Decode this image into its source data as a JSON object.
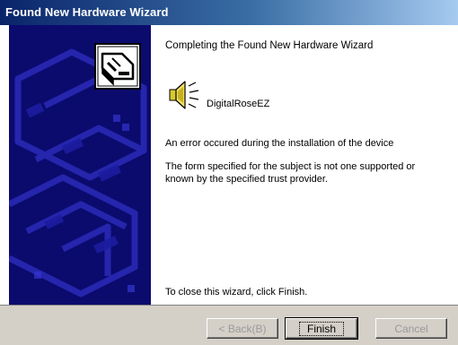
{
  "window": {
    "title": "Found New Hardware Wizard"
  },
  "content": {
    "heading": "Completing the Found New Hardware Wizard",
    "device_name": "DigitalRoseEZ",
    "error_message": "An error occured during the installation of the device",
    "error_detail": "The form specified for the subject is not one supported or known by the specified trust provider.",
    "finish_hint": "To close this wizard, click Finish."
  },
  "buttons": {
    "back_label": "< Back(B)",
    "finish_label": "Finish",
    "cancel_label": "Cancel"
  },
  "icons": {
    "side_panel": "hardware-card-icon",
    "device": "speaker-icon"
  },
  "colors": {
    "side_panel": "#0b0b6e",
    "title_bar": "#0a246a",
    "button_face": "#d4d0c8",
    "disabled_text": "#9a9a9a"
  },
  "state": {
    "back_enabled": false,
    "cancel_enabled": false
  }
}
